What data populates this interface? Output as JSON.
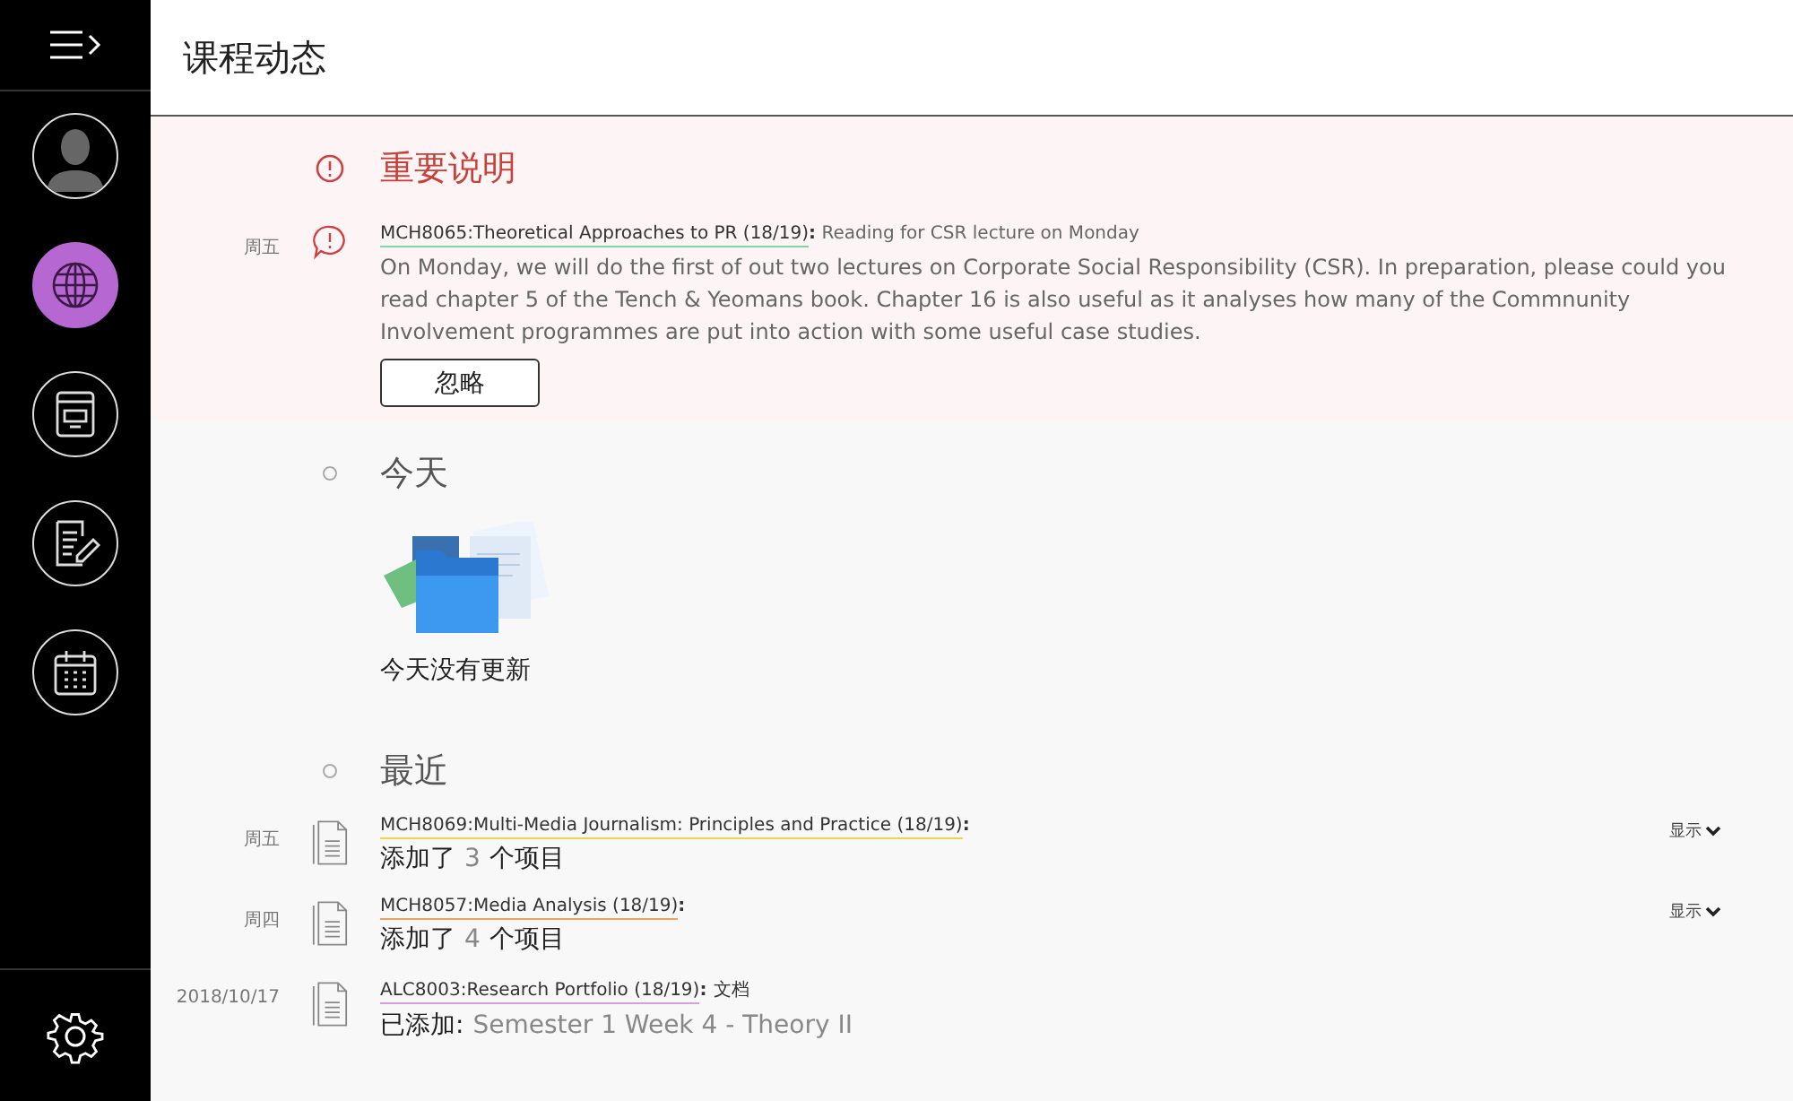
{
  "sidebar": {
    "nav_items": [
      {
        "kind": "profile",
        "selected": false
      },
      {
        "kind": "globe",
        "selected": true
      },
      {
        "kind": "book",
        "selected": false
      },
      {
        "kind": "grades",
        "selected": false
      },
      {
        "kind": "calendar",
        "selected": false
      }
    ]
  },
  "header": {
    "title": "课程动态"
  },
  "important": {
    "title": "重要说明",
    "items": [
      {
        "day": "周五",
        "course": "MCH8065:Theoretical Approaches to PR (18/19)",
        "separator": ":",
        "color": "#7fd6a0",
        "summary": "Reading for CSR lecture on Monday",
        "body": "On Monday, we will do the first of out two lectures on Corporate Social Responsibility (CSR). In preparation, please could you read chapter 5 of the Tench & Yeomans book. Chapter 16 is also useful as it analyses how many of the Commnunity Involvement programmes are put into action with some useful case studies.",
        "dismiss": "忽略"
      }
    ]
  },
  "today": {
    "title": "今天",
    "empty_text": "今天没有更新"
  },
  "recent": {
    "title": "最近",
    "items": [
      {
        "day": "周五",
        "course": "MCH8069:Multi-Media Journalism: Principles and Practice (18/19)",
        "separator": ":",
        "color": "#f2d44a",
        "action": "添加了",
        "detail": "3",
        "suffix": "个项目",
        "show": "显示"
      },
      {
        "day": "周四",
        "course": "MCH8057:Media Analysis (18/19)",
        "separator": ":",
        "color": "#f0a060",
        "action": "添加了",
        "detail": "4",
        "suffix": "个项目",
        "show": "显示"
      },
      {
        "day": "2018/10/17",
        "course": "ALC8003:Research Portfolio (18/19)",
        "separator": ":",
        "color": "#d79ee0",
        "type": "文档",
        "action": "已添加:",
        "detail": "Semester 1 Week 4 - Theory II"
      }
    ]
  }
}
